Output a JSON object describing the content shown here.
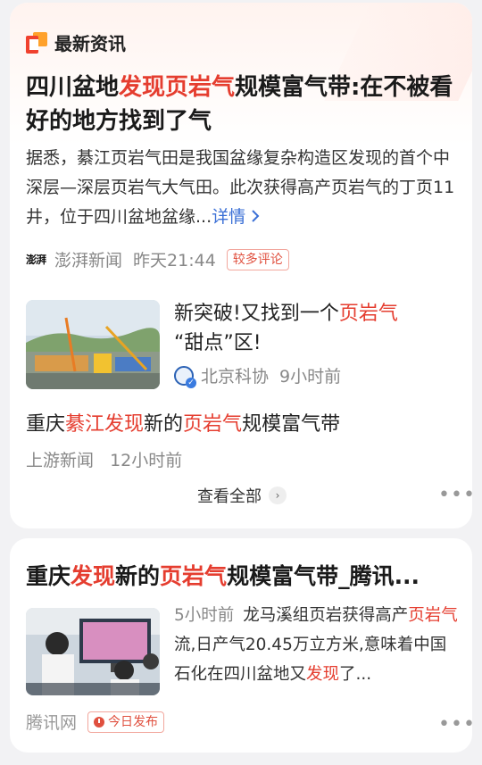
{
  "section": {
    "title": "最新资讯"
  },
  "card1": {
    "headline": {
      "p1": "四川盆地",
      "p2": "发现页岩气",
      "p3": "规模富气带:在不被看好的地方找到了气"
    },
    "summary": "据悉，綦江页岩气田是我国盆缘复杂构造区发现的首个中深层—深层页岩气大气田。此次获得高产页岩气的丁页11井，位于四川盆地盆缘...",
    "more_label": "详情",
    "source": {
      "logo_text": "澎湃",
      "name": "澎湃新闻",
      "time": "昨天21:44",
      "badge": "较多评论"
    },
    "item2": {
      "title_p1": "新突破!又找到一个",
      "title_p2": "页岩气",
      "title_p3": "“甜点”区!",
      "source": "北京科协",
      "time": "9小时前"
    },
    "item3": {
      "title_p1": "重庆",
      "title_p2": "綦江发现",
      "title_p3": "新的",
      "title_p4": "页岩气",
      "title_p5": "规模富气带",
      "source": "上游新闻",
      "time": "12小时前"
    },
    "view_all": "查看全部"
  },
  "card2": {
    "title": {
      "p1": "重庆",
      "p2": "发现",
      "p3": "新的",
      "p4": "页岩气",
      "p5": "规模富气带_腾讯..."
    },
    "time": "5小时前",
    "text": {
      "p1": "龙马溪组页岩获得高产",
      "p2": "页岩气",
      "p3": "流,日产气20.45万立方米,意味着中国石化在四川盆地又",
      "p4": "发现",
      "p5": "了..."
    },
    "source": "腾讯网",
    "badge": "今日发布"
  },
  "colors": {
    "accent_red": "#e53d2f",
    "link_blue": "#3a6fd6",
    "meta_gray": "#888888"
  }
}
